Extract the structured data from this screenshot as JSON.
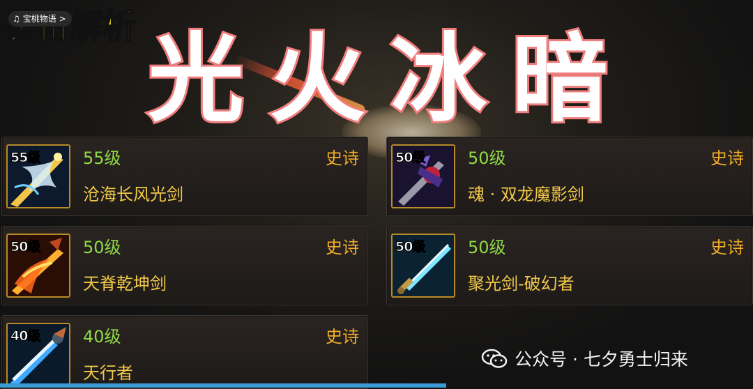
{
  "tag": {
    "label": "装备解析",
    "pill": "宝桃物语 >"
  },
  "title_chars": [
    "光",
    "火",
    "冰",
    "暗"
  ],
  "items": [
    {
      "icon": "angel-wing-sword-icon",
      "icon_level": "55级",
      "level": "55级",
      "rarity": "史诗",
      "name": "沧海长风光剑"
    },
    {
      "icon": "dark-dragon-sword-icon",
      "icon_level": "50级",
      "level": "50级",
      "rarity": "史诗",
      "name": "魂 · 双龙魔影剑"
    },
    {
      "icon": "flame-sword-icon",
      "icon_level": "50级",
      "level": "50级",
      "rarity": "史诗",
      "name": "天脊乾坤剑"
    },
    {
      "icon": "ice-light-sword-icon",
      "icon_level": "50级",
      "level": "50级",
      "rarity": "史诗",
      "name": "聚光剑-破幻者"
    },
    {
      "icon": "blue-light-sword-icon",
      "icon_level": "40级",
      "level": "40级",
      "rarity": "史诗",
      "name": "天行者"
    }
  ],
  "watermark": "公众号 · 七夕勇士归来",
  "colors": {
    "level": "#8fd946",
    "rarity": "#f2ae2a",
    "name": "#f2c84a",
    "frame": "#b88a28",
    "title_stroke": "#f07e7e"
  }
}
